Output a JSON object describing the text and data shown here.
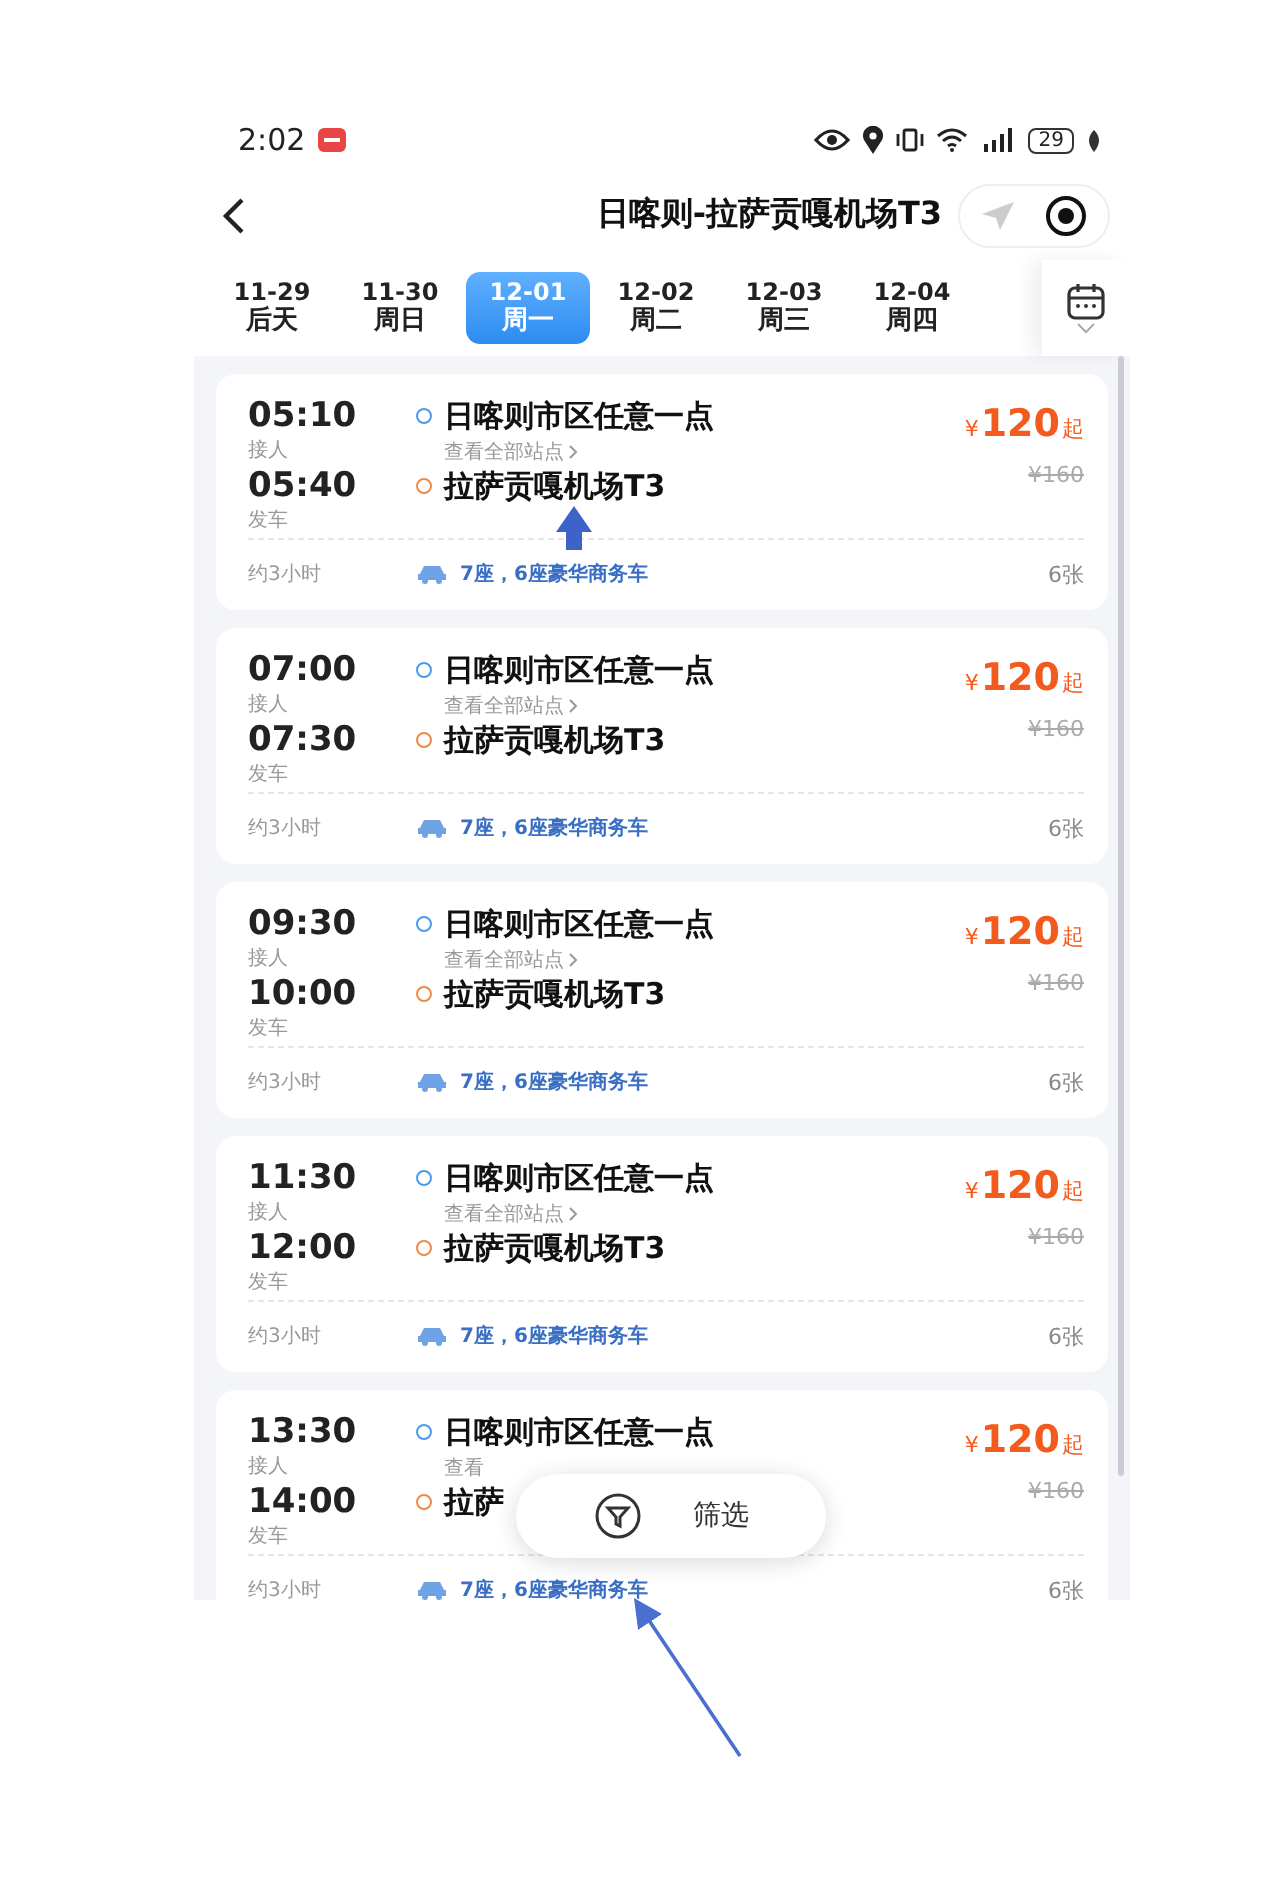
{
  "status_bar": {
    "time": "2:02",
    "battery": "29"
  },
  "header": {
    "title": "日喀则-拉萨贡嘎机场T3"
  },
  "dates": [
    {
      "date": "11-29",
      "day": "后天",
      "selected": false
    },
    {
      "date": "11-30",
      "day": "周日",
      "selected": false
    },
    {
      "date": "12-01",
      "day": "周一",
      "selected": true
    },
    {
      "date": "12-02",
      "day": "周二",
      "selected": false
    },
    {
      "date": "12-03",
      "day": "周三",
      "selected": false
    },
    {
      "date": "12-04",
      "day": "周四",
      "selected": false
    }
  ],
  "trips": [
    {
      "pickup_time": "05:10",
      "pickup_label": "接人",
      "depart_time": "05:40",
      "depart_label": "发车",
      "origin": "日喀则市区任意一点",
      "stops_link": "查看全部站点",
      "destination": "拉萨贡嘎机场T3",
      "currency": "¥",
      "price": "120",
      "price_suffix": "起",
      "original_price": "¥160",
      "duration": "约3小时",
      "vehicle": "7座，6座豪华商务车",
      "tickets": "6张"
    },
    {
      "pickup_time": "07:00",
      "pickup_label": "接人",
      "depart_time": "07:30",
      "depart_label": "发车",
      "origin": "日喀则市区任意一点",
      "stops_link": "查看全部站点",
      "destination": "拉萨贡嘎机场T3",
      "currency": "¥",
      "price": "120",
      "price_suffix": "起",
      "original_price": "¥160",
      "duration": "约3小时",
      "vehicle": "7座，6座豪华商务车",
      "tickets": "6张"
    },
    {
      "pickup_time": "09:30",
      "pickup_label": "接人",
      "depart_time": "10:00",
      "depart_label": "发车",
      "origin": "日喀则市区任意一点",
      "stops_link": "查看全部站点",
      "destination": "拉萨贡嘎机场T3",
      "currency": "¥",
      "price": "120",
      "price_suffix": "起",
      "original_price": "¥160",
      "duration": "约3小时",
      "vehicle": "7座，6座豪华商务车",
      "tickets": "6张"
    },
    {
      "pickup_time": "11:30",
      "pickup_label": "接人",
      "depart_time": "12:00",
      "depart_label": "发车",
      "origin": "日喀则市区任意一点",
      "stops_link": "查看全部站点",
      "destination": "拉萨贡嘎机场T3",
      "currency": "¥",
      "price": "120",
      "price_suffix": "起",
      "original_price": "¥160",
      "duration": "约3小时",
      "vehicle": "7座，6座豪华商务车",
      "tickets": "6张"
    },
    {
      "pickup_time": "13:30",
      "pickup_label": "接人",
      "depart_time": "14:00",
      "depart_label": "发车",
      "origin": "日喀则市区任意一点",
      "stops_link": "查看",
      "destination": "拉萨",
      "currency": "¥",
      "price": "120",
      "price_suffix": "起",
      "original_price": "¥160",
      "duration": "约3小时",
      "vehicle": "7座，6座豪华商务车",
      "tickets": "6张"
    }
  ],
  "filter_button": {
    "label": "筛选"
  }
}
